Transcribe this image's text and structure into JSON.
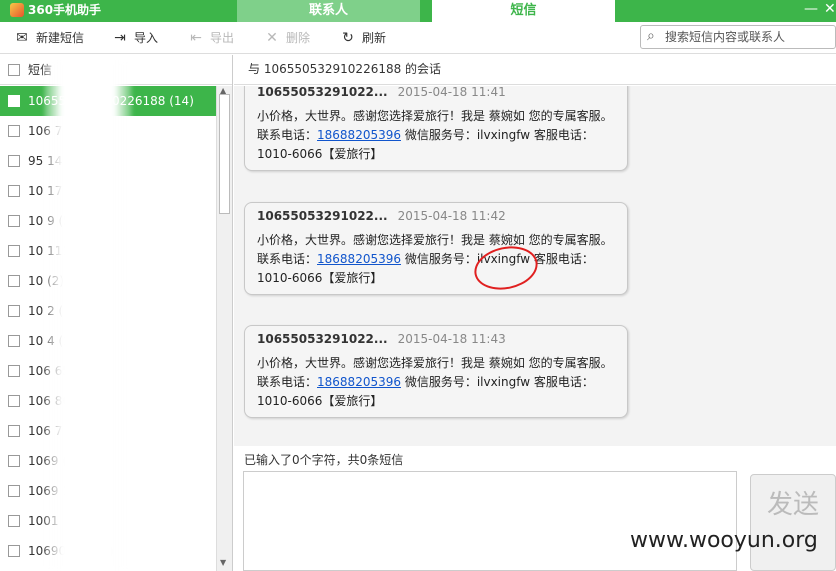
{
  "app": {
    "title": "360手机助手"
  },
  "tabs": [
    {
      "label": "联系人"
    },
    {
      "label": "短信"
    }
  ],
  "window": {
    "minimize": "—",
    "close": "✕"
  },
  "toolbar": {
    "new_sms": "新建短信",
    "import": "导入",
    "export": "导出",
    "delete": "删除",
    "refresh": "刷新"
  },
  "search": {
    "placeholder": "搜索短信内容或联系人"
  },
  "list": {
    "header": "短信",
    "items": [
      {
        "label": "106550532910226188 (14)"
      },
      {
        "label": "106 7 84 (3)"
      },
      {
        "label": "95 14"
      },
      {
        "label": "10 17"
      },
      {
        "label": "10 9 (5)"
      },
      {
        "label": "10 1111 (4)"
      },
      {
        "label": "10 (2)"
      },
      {
        "label": "10 2 (1)"
      },
      {
        "label": "10 4 (2)"
      },
      {
        "label": "106 6510 (1)"
      },
      {
        "label": "106 8013 (1)"
      },
      {
        "label": "106 7 (8)"
      },
      {
        "label": "1069 (1)"
      },
      {
        "label": "1069 1)"
      },
      {
        "label": "1001"
      },
      {
        "label": "10690 032 (2)"
      }
    ]
  },
  "conversation": {
    "header": "与 106550532910226188 的会话",
    "messages": [
      {
        "sender": "10655053291022...",
        "time": "2015-04-18 11:41",
        "text_before": "小价格，大世界。感谢您选择爱旅行！我是 蔡婉如 您的专属客服。联系电话：",
        "phone": "18688205396",
        "text_after": " 微信服务号：ilvxingfw 客服电话：1010-6066【爱旅行】"
      },
      {
        "sender": "10655053291022...",
        "time": "2015-04-18 11:42",
        "text_before": "小价格，大世界。感谢您选择爱旅行！我是 蔡婉如 您的专属客服。联系电话：",
        "phone": "18688205396",
        "text_after": " 微信服务号：ilvxingfw 客服电话：1010-6066【爱旅行】"
      },
      {
        "sender": "10655053291022...",
        "time": "2015-04-18 11:43",
        "text_before": "小价格，大世界。感谢您选择爱旅行！我是 蔡婉如 您的专属客服。联系电话：",
        "phone": "18688205396",
        "text_after": " 微信服务号：ilvxingfw 客服电话：1010-6066【爱旅行】"
      }
    ]
  },
  "compose": {
    "status": "已输入了0个字符，共0条短信",
    "send_label": "发送"
  },
  "watermark": "www.wooyun.org"
}
